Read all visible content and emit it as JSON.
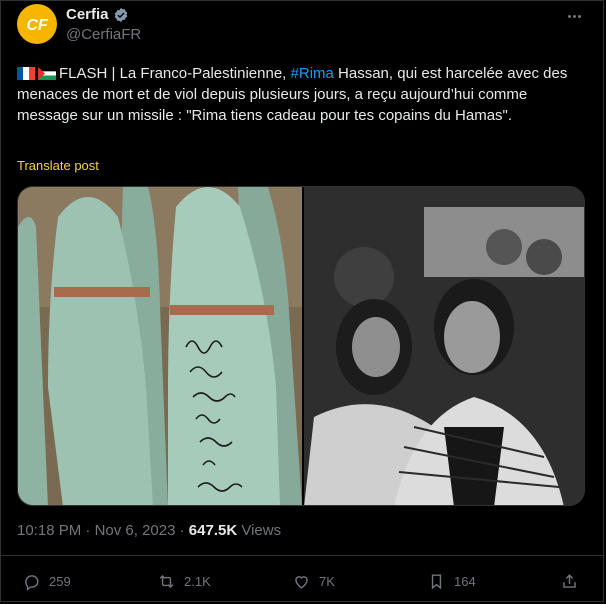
{
  "author": {
    "name": "Cerfia",
    "handle": "@CerfiaFR",
    "avatar_text": "CF",
    "verified_icon": "verified-badge-icon"
  },
  "post": {
    "flags": [
      "fr-flag",
      "ps-flag"
    ],
    "text_before_hashtag": "FLASH | La Franco-Palestinienne, ",
    "hashtag": "#Rima",
    "text_after_hashtag": " Hassan, qui est harcelée avec des menaces de mort et de viol depuis plusieurs jours, a reçu aujourd’hui comme message sur un missile : \"Rima tiens cadeau pour tes copains du Hamas\".",
    "translate_label": "Translate post"
  },
  "media": {
    "left_image": "missiles-with-handwritten-message",
    "right_image": "woman-in-keffiyeh-at-protest"
  },
  "meta": {
    "time": "10:18 PM",
    "separator": " · ",
    "date": "Nov 6, 2023",
    "separator2": " · ",
    "views_count": "647.5K",
    "views_label": " Views"
  },
  "actions": {
    "replies": "259",
    "reposts": "2.1K",
    "likes": "7K",
    "bookmarks": "164"
  },
  "colors": {
    "background": "#000000",
    "link": "#1d9bf0",
    "muted": "#71767b",
    "translate": "#f5d33a",
    "avatar_bg": "#f7b500"
  }
}
